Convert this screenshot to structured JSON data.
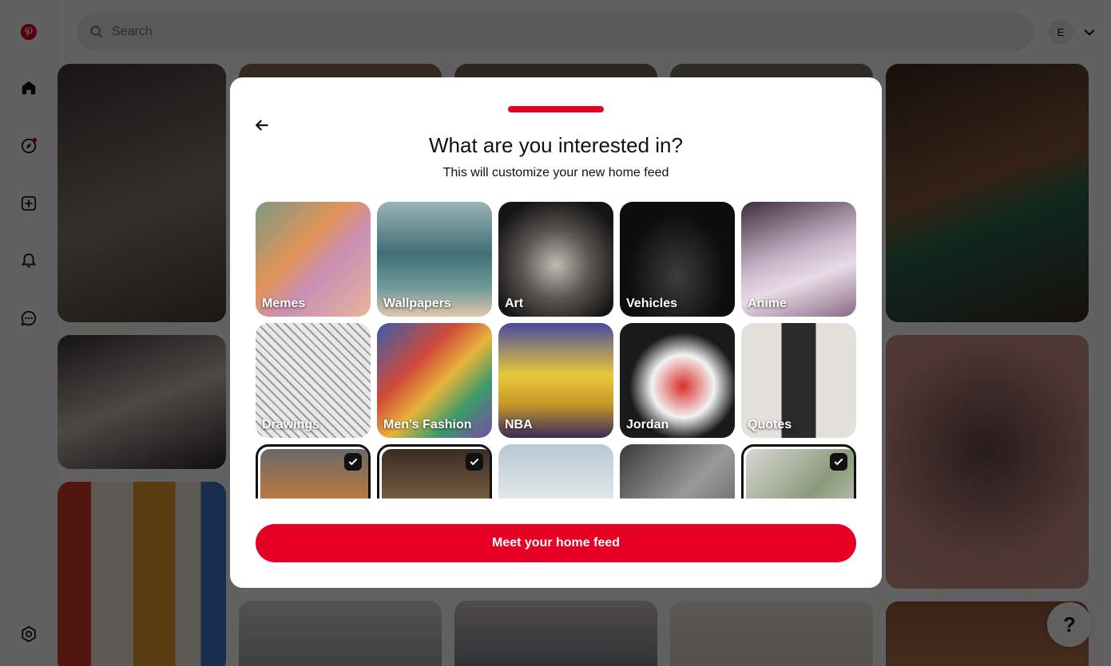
{
  "app": {
    "search_placeholder": "Search",
    "avatar_initial": "E",
    "help_label": "?",
    "brand_color": "#e60023",
    "sidebar_icons": [
      "pinterest-logo-icon",
      "home-icon",
      "explore-icon",
      "create-icon",
      "notifications-icon",
      "messages-icon",
      "settings-icon"
    ]
  },
  "modal": {
    "title": "What are you interested in?",
    "subtitle": "This will customize your new home feed",
    "topics": [
      {
        "label": "Memes",
        "selected": false
      },
      {
        "label": "Wallpapers",
        "selected": false
      },
      {
        "label": "Art",
        "selected": false
      },
      {
        "label": "Vehicles",
        "selected": false
      },
      {
        "label": "Anime",
        "selected": false
      },
      {
        "label": "Drawings",
        "selected": false
      },
      {
        "label": "Men's Fashion",
        "selected": false
      },
      {
        "label": "NBA",
        "selected": false
      },
      {
        "label": "Jordan",
        "selected": false
      },
      {
        "label": "Quotes",
        "selected": false
      },
      {
        "label": "",
        "selected": true
      },
      {
        "label": "",
        "selected": true
      },
      {
        "label": "",
        "selected": false
      },
      {
        "label": "",
        "selected": false
      },
      {
        "label": "",
        "selected": true
      }
    ],
    "cta_label": "Meet your home feed"
  }
}
